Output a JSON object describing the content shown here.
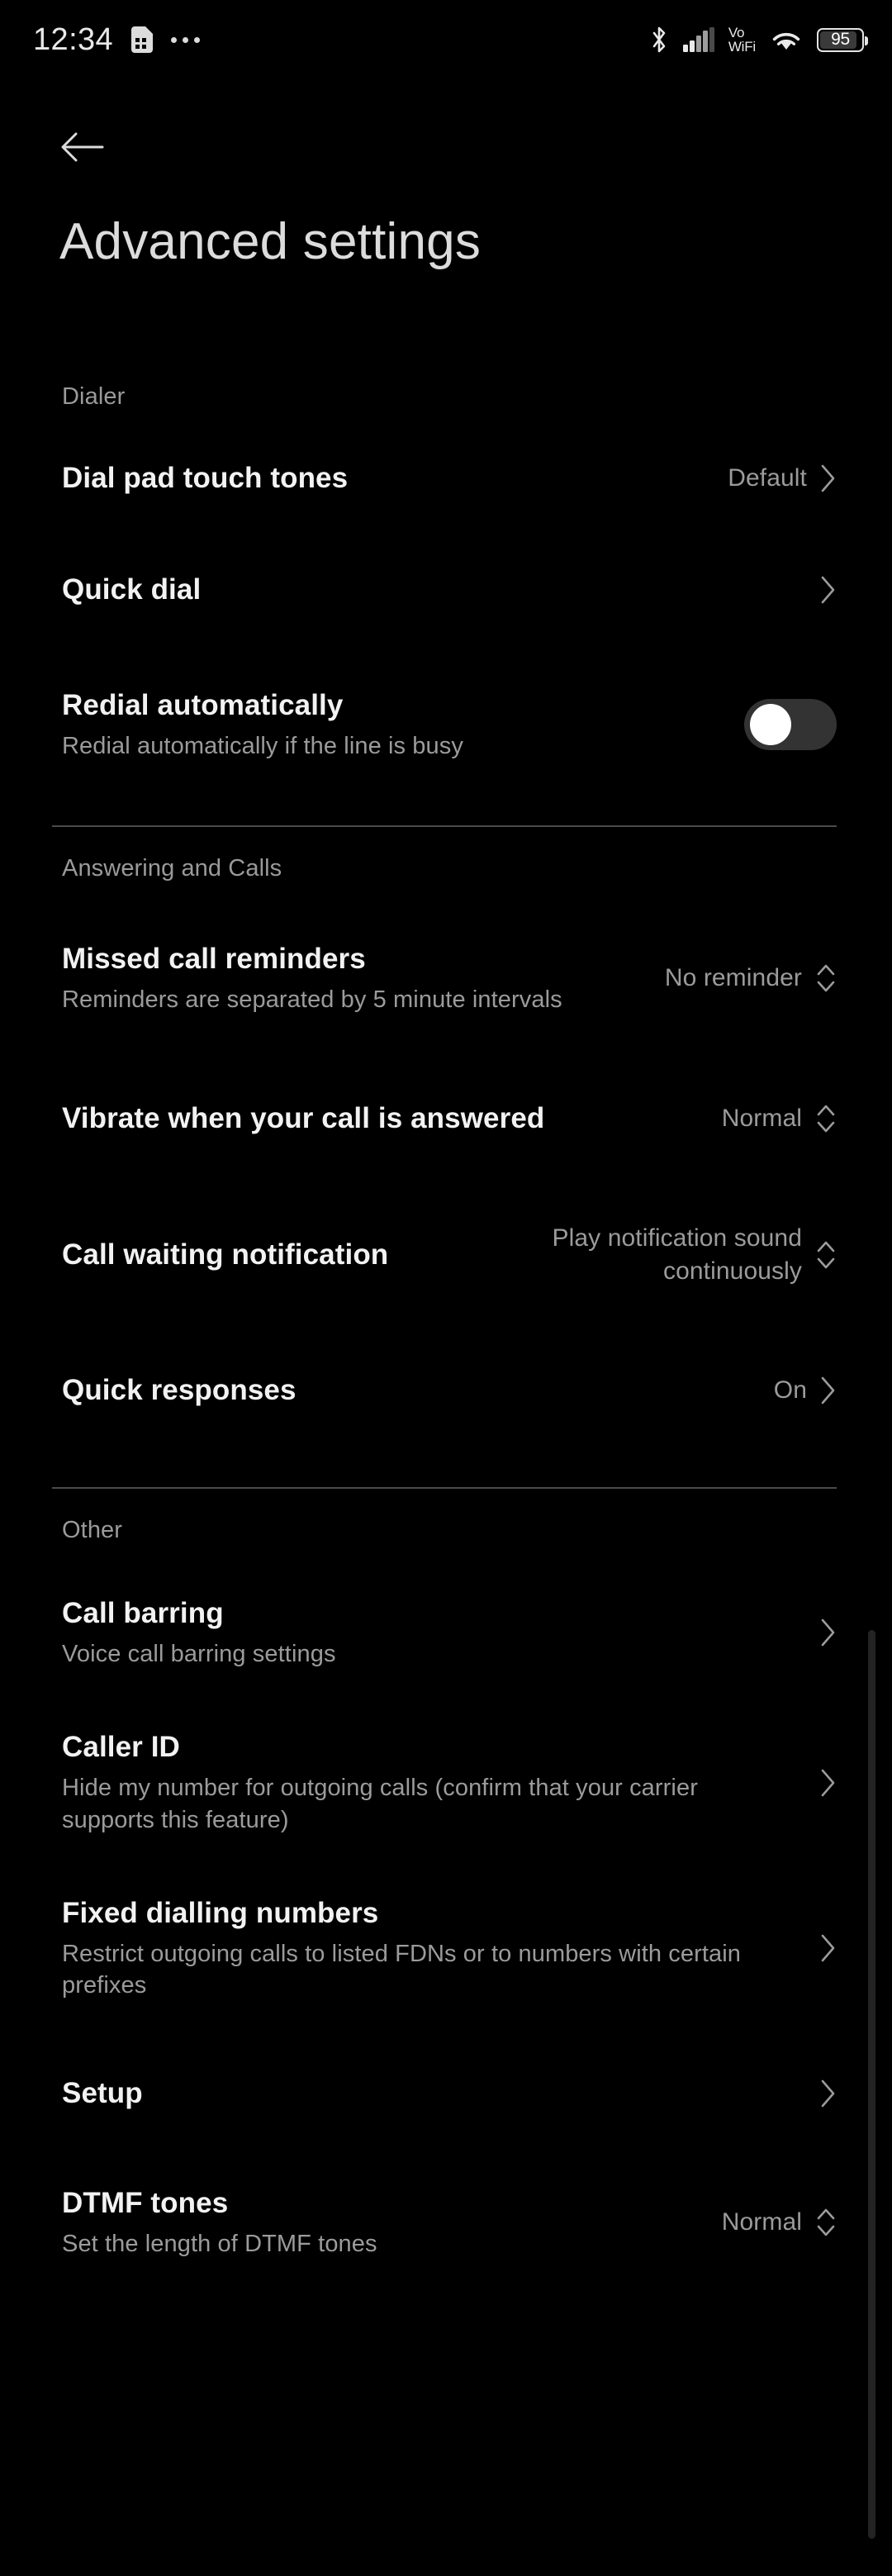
{
  "status_bar": {
    "clock": "12:34",
    "sim_icon": "sim-card-icon",
    "more_icon": "more-notifications-icon",
    "bluetooth_icon": "bluetooth-icon",
    "signal_icon": "cellular-signal-icon",
    "volte_line1": "Vo",
    "volte_line2": "WiFi",
    "wifi_icon": "wifi-icon",
    "battery_level": "95"
  },
  "header": {
    "back_icon": "back-arrow-icon",
    "title": "Advanced settings"
  },
  "sections": [
    {
      "label": "Dialer",
      "items": [
        {
          "title": "Dial pad touch tones",
          "subtitle": "",
          "value": "Default",
          "control": "chevron-right"
        },
        {
          "title": "Quick dial",
          "subtitle": "",
          "value": "",
          "control": "chevron-right"
        },
        {
          "title": "Redial automatically",
          "subtitle": "Redial automatically if the line is busy",
          "value": "",
          "control": "toggle",
          "toggle_on": false
        }
      ]
    },
    {
      "label": "Answering and Calls",
      "items": [
        {
          "title": "Missed call reminders",
          "subtitle": "Reminders are separated by 5 minute intervals",
          "value": "No reminder",
          "control": "stepper"
        },
        {
          "title": "Vibrate when your call is answered",
          "subtitle": "",
          "value": "Normal",
          "control": "stepper"
        },
        {
          "title": "Call waiting notification",
          "subtitle": "",
          "value": "Play notification sound continuously",
          "control": "stepper"
        },
        {
          "title": "Quick responses",
          "subtitle": "",
          "value": "On",
          "control": "chevron-right"
        }
      ]
    },
    {
      "label": "Other",
      "items": [
        {
          "title": "Call barring",
          "subtitle": "Voice call barring settings",
          "value": "",
          "control": "chevron-right"
        },
        {
          "title": "Caller ID",
          "subtitle": "Hide my number for outgoing calls (confirm that your carrier supports this feature)",
          "value": "",
          "control": "chevron-right"
        },
        {
          "title": "Fixed dialling numbers",
          "subtitle": "Restrict outgoing calls to listed FDNs or to numbers with certain prefixes",
          "value": "",
          "control": "chevron-right"
        },
        {
          "title": "Setup",
          "subtitle": "",
          "value": "",
          "control": "chevron-right"
        },
        {
          "title": "DTMF tones",
          "subtitle": "Set the length of DTMF tones",
          "value": "Normal",
          "control": "stepper"
        }
      ]
    }
  ],
  "colors": {
    "background": "#000000",
    "title_text": "#dcdcdc",
    "primary_text": "#f2f2f2",
    "secondary_text": "#9b9b9b",
    "divider": "#4a4a4a",
    "toggle_track": "#333333",
    "toggle_knob": "#ffffff",
    "scrollbar": "#232323"
  }
}
